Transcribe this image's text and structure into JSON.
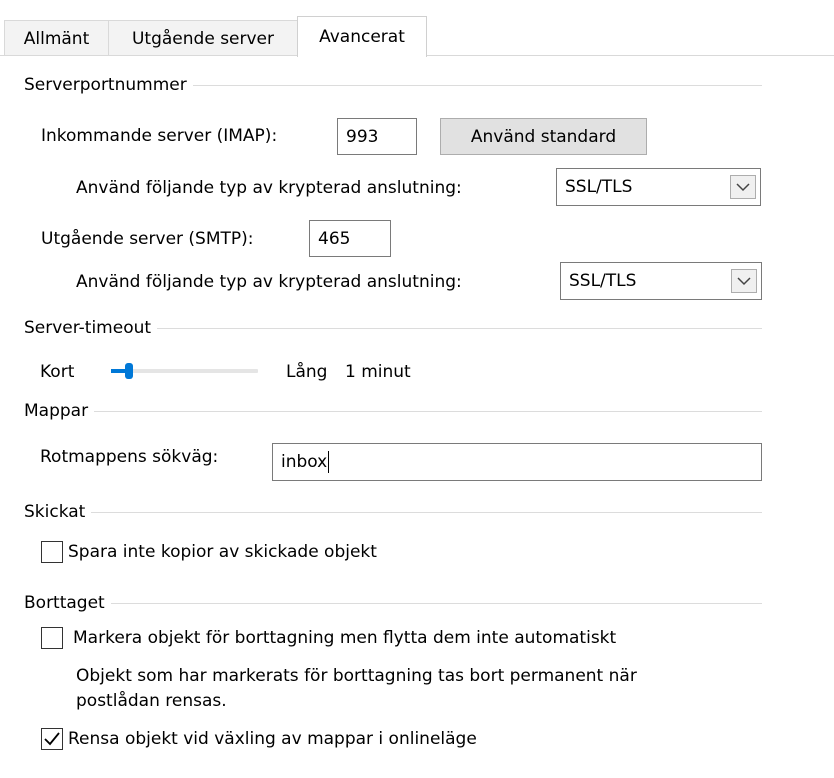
{
  "tabs": [
    {
      "label": "Allmänt"
    },
    {
      "label": "Utgående server"
    },
    {
      "label": "Avancerat",
      "active": true
    }
  ],
  "serverports": {
    "heading": "Serverportnummer",
    "incoming_label": "Inkommande server (IMAP):",
    "incoming_port": "993",
    "default_button": "Använd standard",
    "encryption_label": "Använd följande typ av krypterad anslutning:",
    "incoming_encryption": "SSL/TLS",
    "outgoing_label": "Utgående server (SMTP):",
    "outgoing_port": "465",
    "outgoing_encryption": "SSL/TLS"
  },
  "timeout": {
    "heading": "Server-timeout",
    "short_label": "Kort",
    "long_label": "Lång",
    "value_label": "1 minut",
    "level": 0.1
  },
  "folders": {
    "heading": "Mappar",
    "root_label": "Rotmappens sökväg:",
    "root_value": "inbox"
  },
  "sent": {
    "heading": "Skickat",
    "dont_save_label": "Spara inte kopior av skickade objekt",
    "dont_save_checked": false
  },
  "deleted": {
    "heading": "Borttaget",
    "mark_label": "Markera objekt för borttagning men flytta dem inte automatiskt",
    "mark_checked": false,
    "info_line1": "Objekt som har markerats för borttagning tas bort permanent när",
    "info_line2": "postlådan rensas.",
    "purge_label": "Rensa objekt vid växling av mappar i onlineläge",
    "purge_checked": true
  }
}
